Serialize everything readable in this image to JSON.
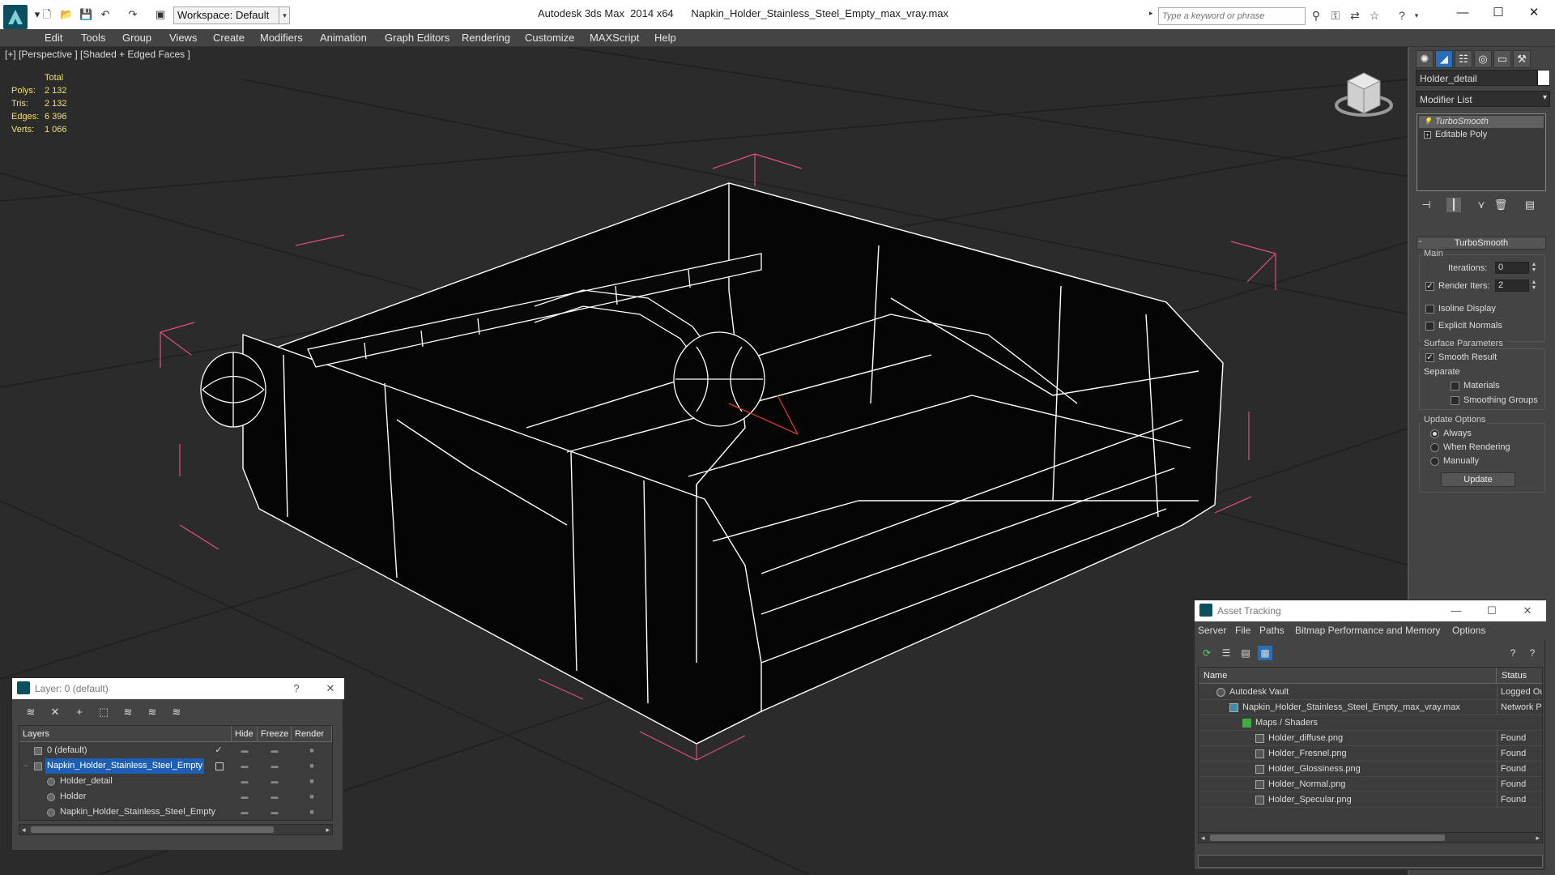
{
  "titlebar": {
    "workspace": "Workspace: Default",
    "app": "Autodesk 3ds Max  2014 x64",
    "file": "Napkin_Holder_Stainless_Steel_Empty_max_vray.max",
    "search_placeholder": "Type a keyword or phrase"
  },
  "menubar": [
    "Edit",
    "Tools",
    "Group",
    "Views",
    "Create",
    "Modifiers",
    "Animation",
    "Graph Editors",
    "Rendering",
    "Customize",
    "MAXScript",
    "Help"
  ],
  "viewport": {
    "label": "[+] [Perspective ] [Shaded + Edged Faces ]",
    "stats": {
      "header": "Total",
      "polys_label": "Polys:",
      "polys": "2 132",
      "tris_label": "Tris:",
      "tris": "2 132",
      "edges_label": "Edges:",
      "edges": "6 396",
      "verts_label": "Verts:",
      "verts": "1 066"
    }
  },
  "command_panel": {
    "object_name": "Holder_detail",
    "modifier_list": "Modifier List",
    "stack": [
      "TurboSmooth",
      "Editable Poly"
    ],
    "rollout_title": "TurboSmooth",
    "main_group": "Main",
    "iterations_label": "Iterations:",
    "iterations_value": "0",
    "render_iters_label": "Render Iters:",
    "render_iters_value": "2",
    "isoline_label": "Isoline Display",
    "explicit_normals_label": "Explicit Normals",
    "surface_group": "Surface Parameters",
    "smooth_result_label": "Smooth Result",
    "separate_label": "Separate",
    "materials_label": "Materials",
    "smoothing_groups_label": "Smoothing Groups",
    "update_group": "Update Options",
    "always_label": "Always",
    "when_rendering_label": "When Rendering",
    "manually_label": "Manually",
    "update_button": "Update"
  },
  "layer_dialog": {
    "title": "Layer: 0 (default)",
    "help": "?",
    "col_layers": "Layers",
    "col_hide": "Hide",
    "col_freeze": "Freeze",
    "col_render": "Render",
    "rows": [
      {
        "name": "0 (default)"
      },
      {
        "name": "Napkin_Holder_Stainless_Steel_Empty"
      },
      {
        "name": "Holder_detail"
      },
      {
        "name": "Holder"
      },
      {
        "name": "Napkin_Holder_Stainless_Steel_Empty"
      }
    ]
  },
  "asset_dialog": {
    "title": "Asset Tracking",
    "menu": [
      "Server",
      "File",
      "Paths",
      "Bitmap Performance and Memory",
      "Options"
    ],
    "col_name": "Name",
    "col_status": "Status",
    "rows": [
      {
        "name": "Autodesk Vault",
        "status": "Logged Out"
      },
      {
        "name": "Napkin_Holder_Stainless_Steel_Empty_max_vray.max",
        "status": "Network Path"
      },
      {
        "name": "Maps / Shaders",
        "status": ""
      },
      {
        "name": "Holder_diffuse.png",
        "status": "Found"
      },
      {
        "name": "Holder_Fresnel.png",
        "status": "Found"
      },
      {
        "name": "Holder_Glossiness.png",
        "status": "Found"
      },
      {
        "name": "Holder_Normal.png",
        "status": "Found"
      },
      {
        "name": "Holder_Specular.png",
        "status": "Found"
      }
    ]
  },
  "colors": {
    "accent": "#0d4f5e",
    "stats": "#f0e06a",
    "wire": "#ffffff",
    "bbox": "#e0507a",
    "selection": "#1e5fb4"
  }
}
